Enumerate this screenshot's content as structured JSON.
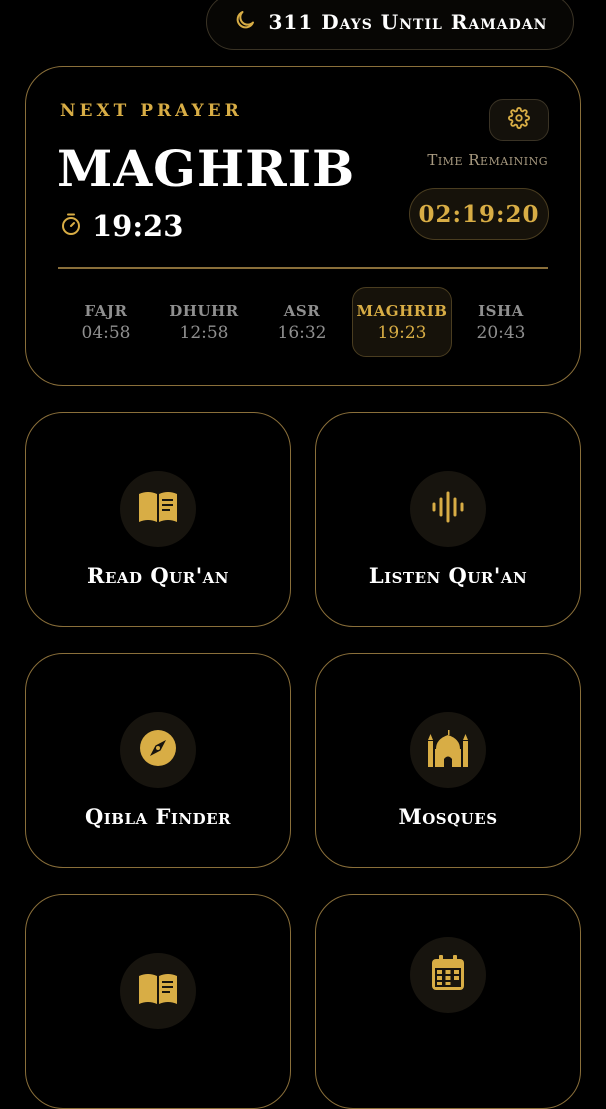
{
  "banner": {
    "ramadan_countdown": "311 Days Until Ramadan"
  },
  "next_prayer": {
    "label": "NEXT PRAYER",
    "name": "MAGHRIB",
    "time": "19:23",
    "time_remaining_label": "Time Remaining",
    "countdown": "02:19:20"
  },
  "schedule": [
    {
      "name": "FAJR",
      "time": "04:58"
    },
    {
      "name": "DHUHR",
      "time": "12:58"
    },
    {
      "name": "ASR",
      "time": "16:32"
    },
    {
      "name": "MAGHRIB",
      "time": "19:23"
    },
    {
      "name": "ISHA",
      "time": "20:43"
    }
  ],
  "tiles": [
    {
      "label": "Read Qur'an",
      "icon": "book-open-icon"
    },
    {
      "label": "Listen Qur'an",
      "icon": "audio-wave-icon"
    },
    {
      "label": "Qibla Finder",
      "icon": "compass-icon"
    },
    {
      "label": "Mosques",
      "icon": "mosque-icon"
    },
    {
      "label": "",
      "icon": "book-open-icon"
    },
    {
      "label": "",
      "icon": "calendar-icon"
    }
  ],
  "colors": {
    "accent": "#d8ad45",
    "border": "#8a6f3a",
    "background": "#000000"
  }
}
